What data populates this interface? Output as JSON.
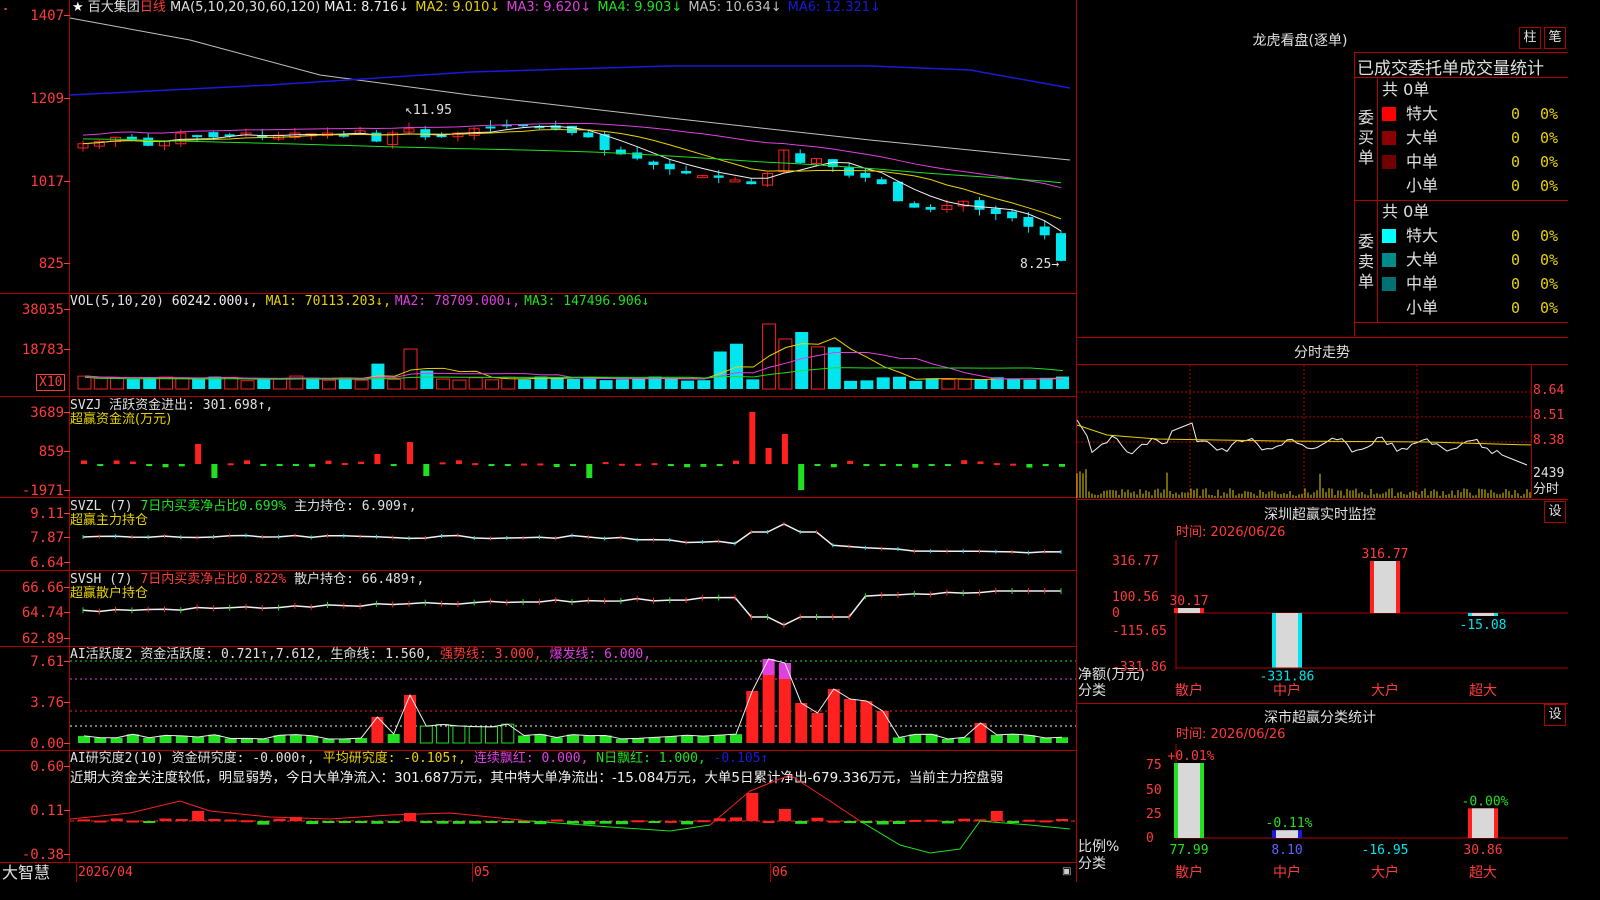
{
  "colors": {
    "up": "#ff2020",
    "down": "#00e5ee",
    "green": "#20e020",
    "grid": "#b00000",
    "yellow": "#e6d200",
    "magenta": "#e040e0",
    "white": "#f0f0f0",
    "blue": "#1a1ad8"
  },
  "main": {
    "star": "★",
    "stock_name": "百大集团",
    "period": "日线",
    "ma_label": "MA(5,10,20,30,60,120)",
    "ma_items": [
      {
        "label": "MA1: 8.716↓",
        "color": "#f0f0f0"
      },
      {
        "label": "MA2: 9.010↓",
        "color": "#e6d200"
      },
      {
        "label": "MA3: 9.620↓",
        "color": "#e040e0"
      },
      {
        "label": "MA4: 9.903↓",
        "color": "#20e020"
      },
      {
        "label": "MA5: 10.634↓",
        "color": "#c0c0c0"
      },
      {
        "label": "MA6: 12.321↓",
        "color": "#1a1ad8"
      }
    ],
    "y_ticks": [
      "1407",
      "1209",
      "1017",
      "825"
    ],
    "high_note": "11.95",
    "low_note": "8.25"
  },
  "vol": {
    "label": "VOL(5,10,20)",
    "value": "60242.000↓,",
    "ma_items": [
      {
        "label": "MA1: 70113.203↓,",
        "color": "#e6d200"
      },
      {
        "label": "MA2: 78709.000↓,",
        "color": "#e040e0"
      },
      {
        "label": "MA3: 147496.906↓",
        "color": "#20e020"
      }
    ],
    "y_ticks": [
      "38035",
      "18783"
    ],
    "unit": "X10"
  },
  "svzj": {
    "line1": "SVZJ  活跃资金进出: 301.698↑,",
    "line2": "超赢资金流(万元)",
    "y_ticks": [
      "3689",
      "859",
      "-1971"
    ]
  },
  "svzl": {
    "name": "SVZL (7)",
    "desc": "7日内买卖净占比0.699%",
    "value": "主力持仓: 6.909↑,",
    "line2": "超赢主力持仓",
    "y_ticks": [
      "9.11",
      "7.87",
      "6.64"
    ]
  },
  "svsh": {
    "name": "SVSH (7)",
    "desc": "7日内买卖净占比0.822%",
    "value": "散户持仓: 66.489↑,",
    "line2": "超赢散户持仓",
    "y_ticks": [
      "66.66",
      "64.74",
      "62.89"
    ]
  },
  "ai1": {
    "label": "AI活跃度2 资金活跃度: 0.721↑,7.612, 生命线: 1.560,",
    "strong": "强势线: 3.000,",
    "burst": "爆发线: 6.000,",
    "y_ticks": [
      "7.61",
      "3.76",
      "0.00"
    ]
  },
  "ai2": {
    "label": "AI研究度2(10) 资金研究度: -0.000↑,",
    "avg": "平均研究度: -0.105↑,",
    "cont": "连续飘红: 0.000,",
    "nday": "N日飘红: 1.000,",
    "last": "-0.105↑",
    "comment": "近期大资金关注度较低，明显弱势，今日大单净流入：301.687万元，其中特大单净流出：-15.084万元，大单5日累计净出-679.336万元，当前主力控盘弱",
    "y_ticks": [
      "0.60",
      "0.11",
      "-0.38"
    ]
  },
  "xaxis": {
    "brand": "大智慧",
    "labels": [
      "2026/04",
      "05",
      "06"
    ]
  },
  "lhb": {
    "title": "龙虎看盘(逐单)",
    "btn1": "柱",
    "btn2": "笔",
    "header": "已成交委托单成交量统计",
    "buy_side": "委买单",
    "sell_side": "委卖单",
    "buy_total": "共 0单",
    "sell_total": "共 0单",
    "buy_rows": [
      {
        "name": "特大",
        "count": "0",
        "pct": "0%",
        "color": "#ff0000"
      },
      {
        "name": "大单",
        "count": "0",
        "pct": "0%",
        "color": "#8b0000"
      },
      {
        "name": "中单",
        "count": "0",
        "pct": "0%",
        "color": "#700000"
      },
      {
        "name": "小单",
        "count": "0",
        "pct": "0%",
        "color": ""
      }
    ],
    "sell_rows": [
      {
        "name": "特大",
        "count": "0",
        "pct": "0%",
        "color": "#00ffff"
      },
      {
        "name": "大单",
        "count": "0",
        "pct": "0%",
        "color": "#008b8b"
      },
      {
        "name": "中单",
        "count": "0",
        "pct": "0%",
        "color": "#007070"
      },
      {
        "name": "小单",
        "count": "0",
        "pct": "0%",
        "color": ""
      }
    ]
  },
  "intraday": {
    "title": "分时走势",
    "y_ticks": [
      "8.64",
      "8.51",
      "8.38"
    ],
    "vol_tick": "2439",
    "vol_label": "分时"
  },
  "monitor": {
    "title": "深圳超赢实时监控",
    "btn": "设",
    "time": "时间: 2026/06/26",
    "y_ticks": [
      "316.77",
      "100.56",
      "0",
      "-115.65",
      "-331.86"
    ],
    "y_label1": "净额(万元)",
    "y_label2": "分类",
    "categories": [
      "散户",
      "中户",
      "大户",
      "超大"
    ],
    "values": [
      30.17,
      -331.86,
      316.77,
      -15.08
    ],
    "value_labels": [
      "30.17",
      "-331.86",
      "316.77",
      "-15.08"
    ]
  },
  "classify": {
    "title": "深市超赢分类统计",
    "btn": "设",
    "time": "时间: 2026/06/26",
    "y_ticks": [
      "75",
      "50",
      "25",
      "0"
    ],
    "y_label1": "比例%",
    "y_label2": "分类",
    "categories": [
      "散户",
      "中户",
      "大户",
      "超大"
    ],
    "values": [
      77.99,
      8.1,
      -16.95,
      30.86
    ],
    "value_labels": [
      "77.99",
      "8.10",
      "-16.95",
      "30.86"
    ],
    "change_labels": [
      "+0.01%",
      "-0.11%",
      "",
      "-0.00%"
    ]
  }
}
